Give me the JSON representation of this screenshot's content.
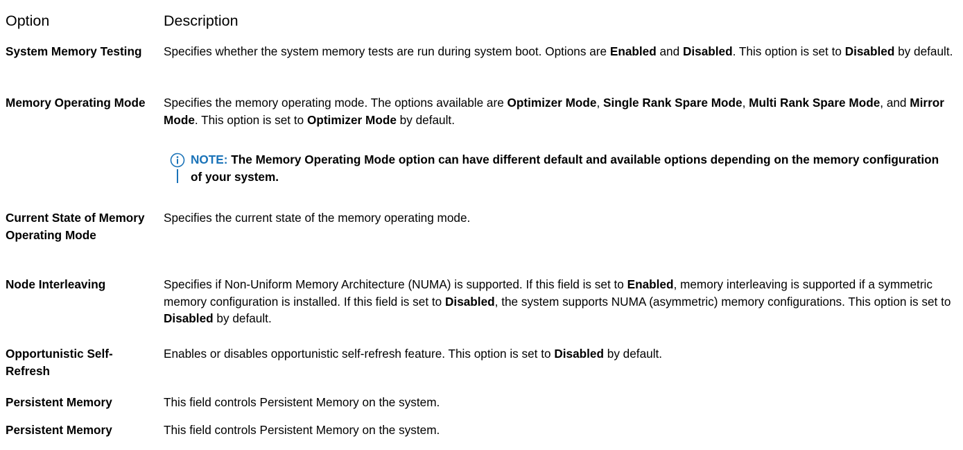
{
  "table": {
    "header": {
      "option": "Option",
      "description": "Description"
    },
    "rows": [
      {
        "option": "System Memory Testing",
        "desc": [
          {
            "t": "Specifies whether the system memory tests are run during system boot. Options are "
          },
          {
            "t": "Enabled",
            "b": true
          },
          {
            "t": " and "
          },
          {
            "t": "Disabled",
            "b": true
          },
          {
            "t": ". This option is set to "
          },
          {
            "t": "Disabled",
            "b": true
          },
          {
            "t": " by default."
          }
        ]
      },
      {
        "option": "Memory Operating Mode",
        "desc": [
          {
            "t": "Specifies the memory operating mode. The options available are "
          },
          {
            "t": "Optimizer Mode",
            "b": true
          },
          {
            "t": ", "
          },
          {
            "t": "Single Rank Spare Mode",
            "b": true
          },
          {
            "t": ", "
          },
          {
            "t": "Multi Rank Spare Mode",
            "b": true
          },
          {
            "t": ", and "
          },
          {
            "t": "Mirror Mode",
            "b": true
          },
          {
            "t": ". This option is set to "
          },
          {
            "t": "Optimizer Mode",
            "b": true
          },
          {
            "t": " by default."
          }
        ]
      },
      {
        "option": "Current State of Memory Operating Mode",
        "desc": [
          {
            "t": "Specifies the current state of the memory operating mode."
          }
        ]
      },
      {
        "option": "Node Interleaving",
        "desc": [
          {
            "t": "Specifies if Non-Uniform Memory Architecture (NUMA) is supported. If this field is set to "
          },
          {
            "t": "Enabled",
            "b": true
          },
          {
            "t": ", memory interleaving is supported if a symmetric memory configuration is installed. If this field is set to "
          },
          {
            "t": "Disabled",
            "b": true
          },
          {
            "t": ", the system supports NUMA (asymmetric) memory configurations. This option is set to "
          },
          {
            "t": "Disabled",
            "b": true
          },
          {
            "t": " by default."
          }
        ]
      },
      {
        "option": "Opportunistic Self-Refresh",
        "desc": [
          {
            "t": "Enables or disables opportunistic self-refresh feature. This option is set to "
          },
          {
            "t": "Disabled",
            "b": true
          },
          {
            "t": " by default."
          }
        ]
      },
      {
        "option": "Persistent Memory",
        "desc": [
          {
            "t": "This field controls Persistent Memory on the system."
          }
        ]
      },
      {
        "option": "Persistent Memory",
        "desc": [
          {
            "t": "This field controls Persistent Memory on the system."
          }
        ]
      }
    ]
  },
  "note": {
    "icon": "info-icon",
    "label": "NOTE:",
    "text": " The Memory Operating Mode option can have different default and available options depending on the memory configuration of your system.",
    "color": "#1a73b8"
  }
}
